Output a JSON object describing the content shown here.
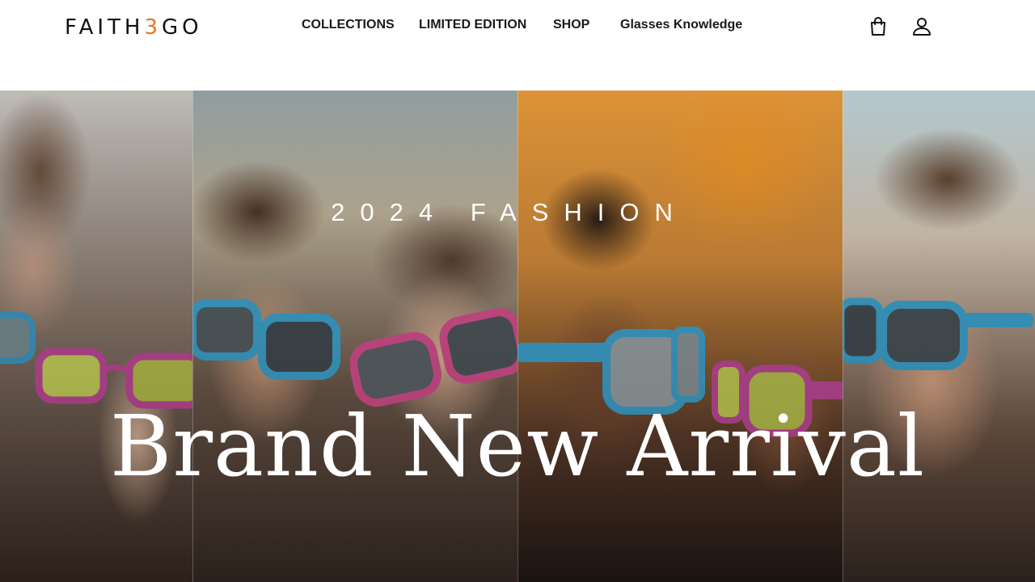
{
  "brand": {
    "logo_text_start": "FAITH",
    "logo_text_mid": "3",
    "logo_text_end": "GO",
    "accent_color": "#e87722"
  },
  "nav": {
    "items": [
      {
        "label": "COLLECTIONS"
      },
      {
        "label": "LIMITED EDITION"
      },
      {
        "label": "SHOP"
      },
      {
        "label": "Glasses Knowledge"
      }
    ]
  },
  "header_icons": {
    "cart": "shopping-bag-icon",
    "account": "user-icon"
  },
  "hero": {
    "eyebrow": "2024 FASHION",
    "headline": "Brand New Arrival"
  }
}
